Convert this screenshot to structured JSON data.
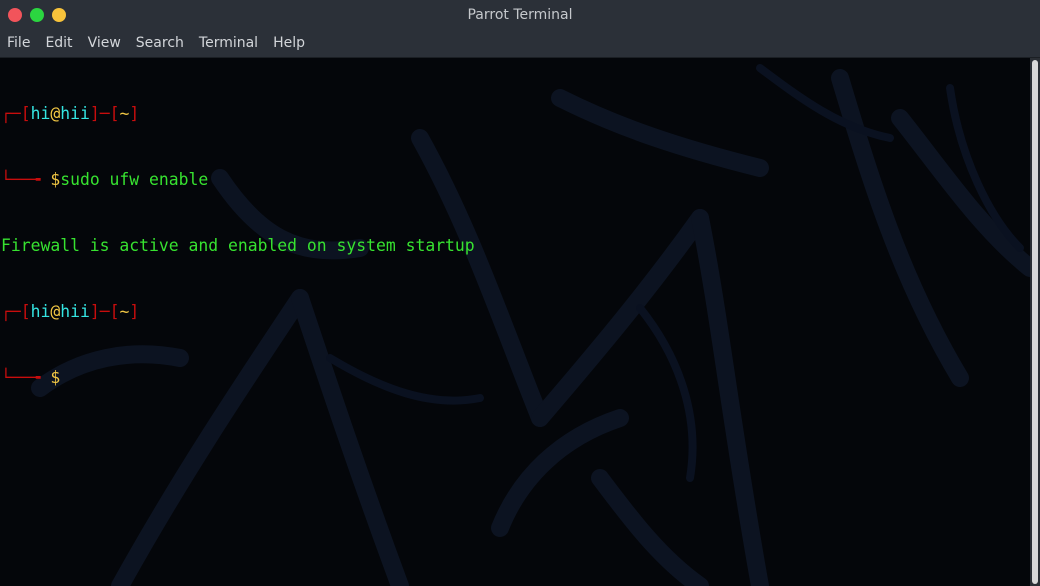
{
  "window": {
    "title": "Parrot Terminal",
    "buttons": {
      "close": {
        "icon": "close-dot-icon",
        "color": "#f2545b"
      },
      "maximize": {
        "icon": "maximize-dot-icon",
        "color": "#2bd640"
      },
      "minimize": {
        "icon": "minimize-dot-icon",
        "color": "#f8c33b"
      }
    }
  },
  "menu": {
    "items": [
      "File",
      "Edit",
      "View",
      "Search",
      "Terminal",
      "Help"
    ]
  },
  "terminal": {
    "prompt": {
      "open_bracket": "[",
      "user": "hi",
      "at": "@",
      "host": "hii",
      "close_bracket": "]",
      "dash": "─",
      "dir_open": "[",
      "dir": "~",
      "dir_close": "]",
      "dollar": "$"
    },
    "command_1": "sudo ufw enable",
    "output_1": "Firewall is active and enabled on system startup",
    "command_2": ""
  },
  "colors": {
    "prompt_red": "#c80d0d",
    "user_cyan": "#34e5e2",
    "at_yellow": "#f2c744",
    "command_green": "#37e230",
    "background": "#04060a"
  }
}
